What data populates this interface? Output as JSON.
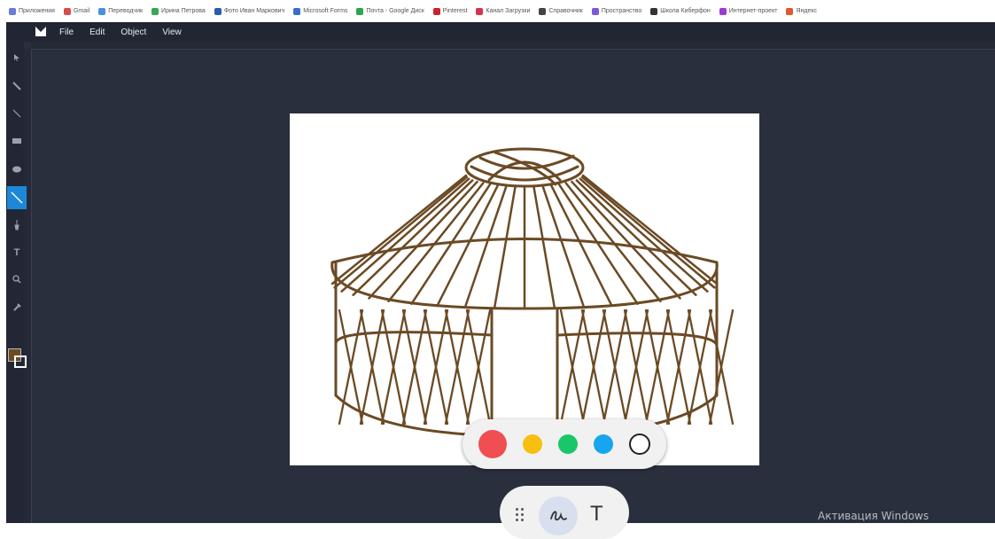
{
  "bookmarks": [
    {
      "label": "Приложения",
      "color": "#6a7bd8"
    },
    {
      "label": "Gmail",
      "color": "#d84c4c"
    },
    {
      "label": "Переводчик",
      "color": "#4a90e2"
    },
    {
      "label": "Ирина Петрова",
      "color": "#3aa757"
    },
    {
      "label": "Фото Иван Маркович",
      "color": "#2b5ea8"
    },
    {
      "label": "Microsoft Forms",
      "color": "#3b6ccf"
    },
    {
      "label": "Почта - Google Диск",
      "color": "#2ea44f"
    },
    {
      "label": "Pinterest",
      "color": "#c8232c"
    },
    {
      "label": "Канал Загрузки",
      "color": "#d8334a"
    },
    {
      "label": "Справочник",
      "color": "#444444"
    },
    {
      "label": "Пространство",
      "color": "#7a5ad8"
    },
    {
      "label": "Школа Киберфон",
      "color": "#333333"
    },
    {
      "label": "Интернет-проект",
      "color": "#9a3ad8"
    },
    {
      "label": "Яндекс",
      "color": "#e0582f"
    }
  ],
  "menu": {
    "file": "File",
    "edit": "Edit",
    "object": "Object",
    "view": "View"
  },
  "colors": {
    "app_bg": "#2a2f3d",
    "stroke": "#6b4a24",
    "active_tool": "#1e88d8"
  },
  "tools": [
    {
      "name": "select-tool",
      "icon": "arrow-icon"
    },
    {
      "name": "pen-tool",
      "icon": "pen-icon"
    },
    {
      "name": "line-tool",
      "icon": "line-icon"
    },
    {
      "name": "rect-tool",
      "icon": "rectangle-icon"
    },
    {
      "name": "ellipse-tool",
      "icon": "ellipse-icon"
    },
    {
      "name": "line-tool-active",
      "icon": "line-icon"
    },
    {
      "name": "brush-tool",
      "icon": "brush-icon"
    },
    {
      "name": "text-tool",
      "icon": "text-icon"
    },
    {
      "name": "zoom-tool",
      "icon": "zoom-icon"
    },
    {
      "name": "eyedropper-tool",
      "icon": "eyedropper-icon"
    }
  ],
  "palette": [
    "#f04e51",
    "#f7c010",
    "#19c76a",
    "#17a5ef",
    "#ffffff"
  ],
  "text_tool_label": "T",
  "watermark": "Активация Windows"
}
